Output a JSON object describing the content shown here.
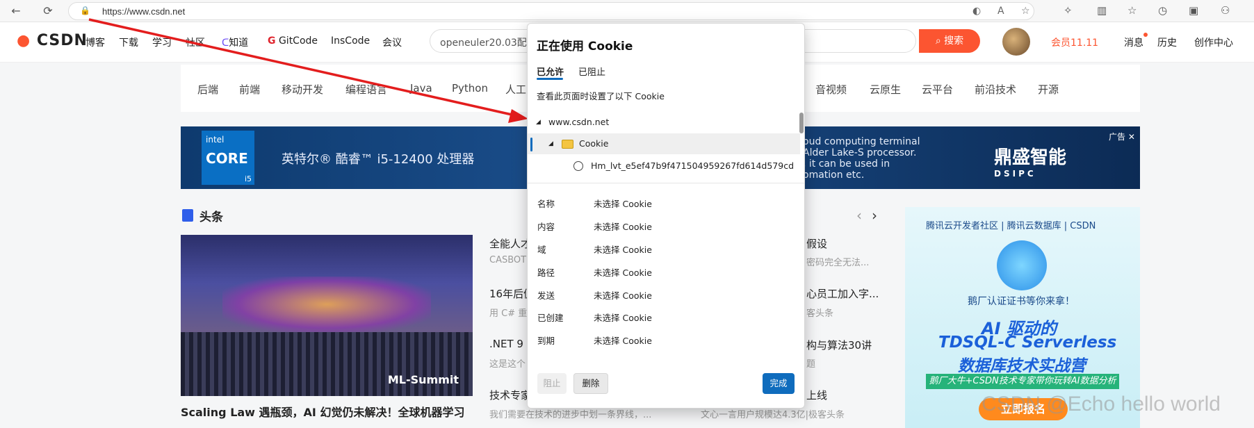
{
  "browser": {
    "url": "https://www.csdn.net",
    "back_icon": "back-arrow-icon",
    "reload_icon": "reload-icon"
  },
  "header": {
    "logo": "CSDN",
    "nav": [
      "博客",
      "下载",
      "学习",
      "社区",
      "知道",
      "GitCode",
      "InsCode",
      "会议"
    ],
    "search_query": "openeuler20.03配置",
    "search_button": "搜索",
    "vip": "会员11.11",
    "messages": "消息",
    "history": "历史",
    "create_center": "创作中心"
  },
  "categories": [
    "后端",
    "前端",
    "移动开发",
    "编程语言",
    "Java",
    "Python",
    "人工",
    "音视频",
    "云原生",
    "云平台",
    "前沿技术",
    "开源"
  ],
  "banner": {
    "intel_brand": "intel",
    "intel_core": "CORE",
    "intel_gen": "i5",
    "text": "英特尔® 酷睿™ i5-12400 处理器",
    "right_text": "oud computing terminal\nAlder Lake-S processor.\n, it can be used in\nomation etc.",
    "brand": "鼎盛智能",
    "brand_sub": "DSIPC",
    "ad_label": "广告"
  },
  "headline": {
    "title": "头条",
    "hero_tag": "ML-Summit",
    "hero_caption": "Scaling Law 遇瓶颈，AI 幻觉仍未解决！全球机器学习",
    "articles": [
      {
        "title": "全能人才",
        "sub": "CASBOT"
      },
      {
        "title": "16年后仍",
        "sub": "用 C# 重"
      },
      {
        "title": ".NET 9",
        "sub": "这是这个"
      },
      {
        "title": "技术专家",
        "sub": "我们需要在技术的进步中划一条界线，..."
      }
    ],
    "right_articles": [
      {
        "title": "假设",
        "sub": "密码完全无法..."
      },
      {
        "title": "心员工加入字...",
        "sub": "客头条"
      },
      {
        "title": "构与算法30讲",
        "sub": "题"
      },
      {
        "title": "上线",
        "sub": "文心一言用户规模达4.3亿|极客头条"
      }
    ]
  },
  "right_ad": {
    "top_line": "腾讯云开发者社区 | 腾讯云数据库 | CSDN",
    "line1": "鹅厂认证证书等你来拿！",
    "line2": "AI 驱动的",
    "line3": "TDSQL-C Serverless",
    "line4": "数据库技术实战营",
    "line5": "鹅厂大牛+CSDN技术专家带你玩转AI数据分析",
    "button": "立即报名"
  },
  "watermark": "CSDN @Echo hello world",
  "cookie_dialog": {
    "title": "正在使用 Cookie",
    "tabs": [
      "已允许",
      "已阻止"
    ],
    "description": "查看此页面时设置了以下 Cookie",
    "tree": {
      "site": "www.csdn.net",
      "folder": "Cookie",
      "cookie_name": "Hm_lvt_e5ef47b9f471504959267fd614d579cd"
    },
    "details": [
      {
        "label": "名称",
        "value": "未选择 Cookie"
      },
      {
        "label": "内容",
        "value": "未选择 Cookie"
      },
      {
        "label": "域",
        "value": "未选择 Cookie"
      },
      {
        "label": "路径",
        "value": "未选择 Cookie"
      },
      {
        "label": "发送",
        "value": "未选择 Cookie"
      },
      {
        "label": "已创建",
        "value": "未选择 Cookie"
      },
      {
        "label": "到期",
        "value": "未选择 Cookie"
      }
    ],
    "block_button": "阻止",
    "delete_button": "删除",
    "done_button": "完成"
  },
  "annotation_color": "#e31d1d"
}
